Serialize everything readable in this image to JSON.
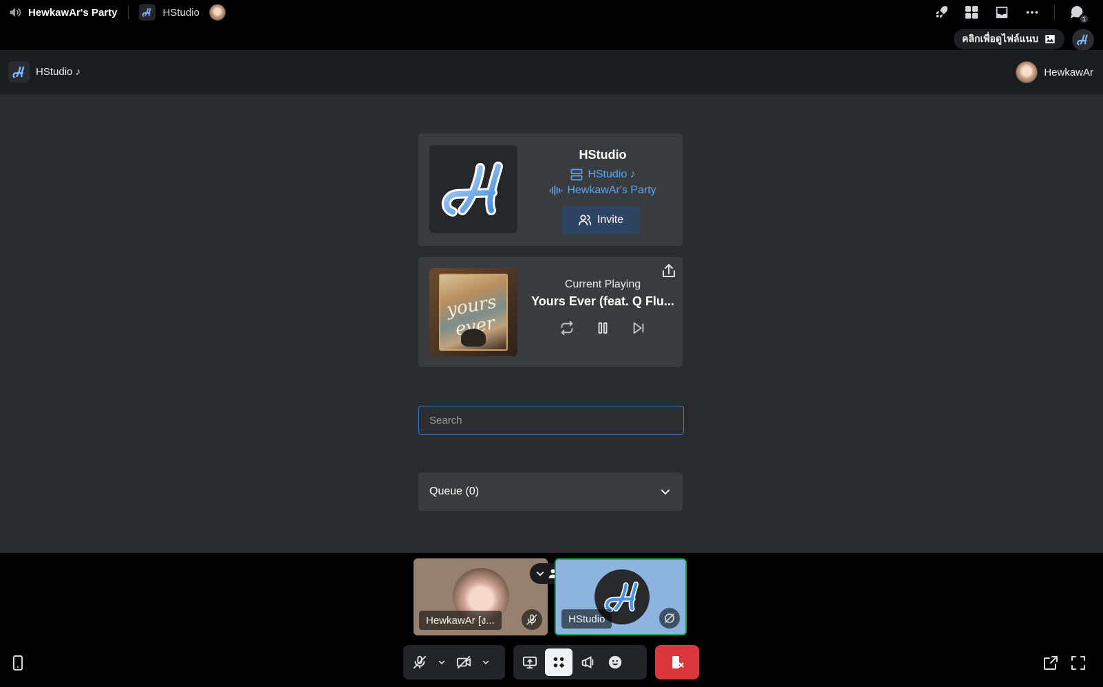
{
  "topbar": {
    "channel_name": "HewkawAr's Party",
    "app_name": "HStudio",
    "notification_count": "1",
    "gallery_label": "คลิกเพื่อดูไฟล์แนบ",
    "icons": [
      "speaker-icon",
      "activity-rocket-icon",
      "grid-icon",
      "inbox-icon",
      "more-icon",
      "threads-icon"
    ]
  },
  "app_header": {
    "title": "HStudio ♪",
    "user_name": "HewkawAr"
  },
  "server_card": {
    "name": "HStudio",
    "server_link": "HStudio ♪",
    "voice_channel": "HewkawAr's Party",
    "invite_label": "Invite",
    "accent": "#5aa7f0"
  },
  "player": {
    "label": "Current Playing",
    "track": "Yours Ever (feat. Q Flu...",
    "cover_text": "yours ever"
  },
  "search": {
    "placeholder": "Search",
    "value": ""
  },
  "queue": {
    "label": "Queue (0)"
  },
  "participants": [
    {
      "name": "HewkawAr [ง...",
      "status": "mic-muted"
    },
    {
      "name": "HStudio",
      "status": "video-off"
    }
  ],
  "colors": {
    "hangup": "#da373c",
    "speaking_border": "#23a559",
    "invite_bg": "#2d4562"
  }
}
